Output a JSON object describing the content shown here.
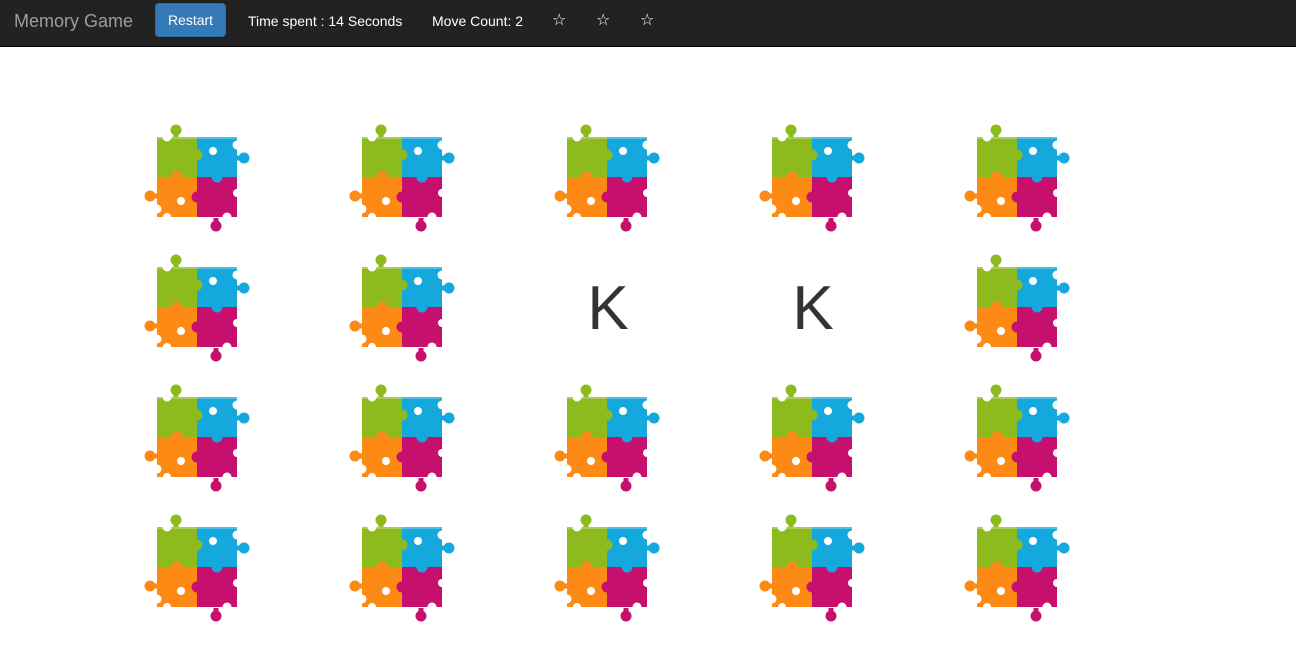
{
  "navbar": {
    "brand": "Memory Game",
    "restart_label": "Restart",
    "time_text": "Time spent : 14 Seconds",
    "move_text": "Move Count: 2",
    "stars": [
      "☆",
      "☆",
      "☆"
    ]
  },
  "colors": {
    "navbar_bg": "#222222",
    "restart_bg": "#337ab7",
    "piece_green": "#8dbb1e",
    "piece_blue": "#14a8dc",
    "piece_orange": "#fd8a14",
    "piece_magenta": "#c7106e"
  },
  "board": {
    "columns": 5,
    "rows": 4,
    "cards": [
      {
        "state": "hidden",
        "icon": "puzzle-icon",
        "value": ""
      },
      {
        "state": "hidden",
        "icon": "puzzle-icon",
        "value": ""
      },
      {
        "state": "hidden",
        "icon": "puzzle-icon",
        "value": ""
      },
      {
        "state": "hidden",
        "icon": "puzzle-icon",
        "value": ""
      },
      {
        "state": "hidden",
        "icon": "puzzle-icon",
        "value": ""
      },
      {
        "state": "hidden",
        "icon": "puzzle-icon",
        "value": ""
      },
      {
        "state": "hidden",
        "icon": "puzzle-icon",
        "value": ""
      },
      {
        "state": "open",
        "icon": "",
        "value": "K"
      },
      {
        "state": "open",
        "icon": "",
        "value": "K"
      },
      {
        "state": "hidden",
        "icon": "puzzle-icon",
        "value": ""
      },
      {
        "state": "hidden",
        "icon": "puzzle-icon",
        "value": ""
      },
      {
        "state": "hidden",
        "icon": "puzzle-icon",
        "value": ""
      },
      {
        "state": "hidden",
        "icon": "puzzle-icon",
        "value": ""
      },
      {
        "state": "hidden",
        "icon": "puzzle-icon",
        "value": ""
      },
      {
        "state": "hidden",
        "icon": "puzzle-icon",
        "value": ""
      },
      {
        "state": "hidden",
        "icon": "puzzle-icon",
        "value": ""
      },
      {
        "state": "hidden",
        "icon": "puzzle-icon",
        "value": ""
      },
      {
        "state": "hidden",
        "icon": "puzzle-icon",
        "value": ""
      },
      {
        "state": "hidden",
        "icon": "puzzle-icon",
        "value": ""
      },
      {
        "state": "hidden",
        "icon": "puzzle-icon",
        "value": ""
      }
    ]
  }
}
